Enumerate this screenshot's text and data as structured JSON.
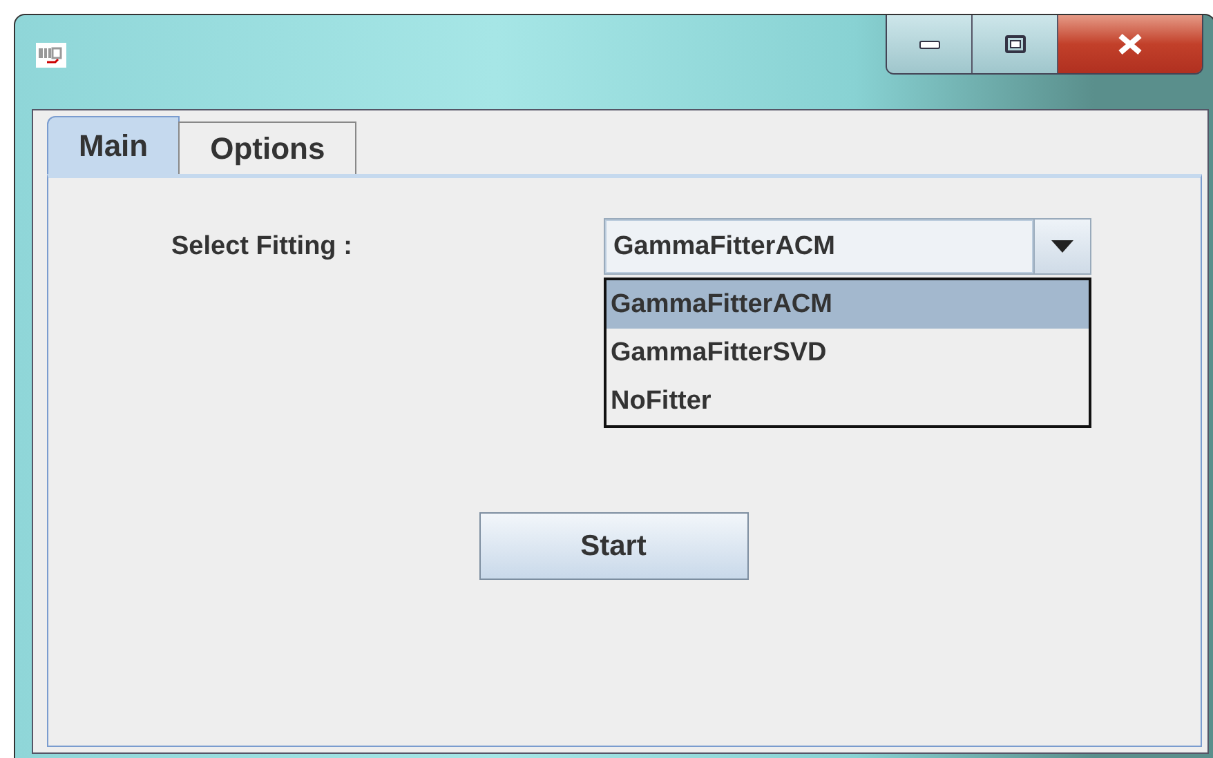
{
  "tabs": [
    {
      "label": "Main",
      "selected": true
    },
    {
      "label": "Options",
      "selected": false
    }
  ],
  "fitting": {
    "label": "Select Fitting :",
    "value": "GammaFitterACM",
    "expanded": true,
    "options": [
      {
        "label": "GammaFitterACM",
        "selected": true
      },
      {
        "label": "GammaFitterSVD",
        "selected": false
      },
      {
        "label": "NoFitter",
        "selected": false
      }
    ]
  },
  "start_button": "Start"
}
